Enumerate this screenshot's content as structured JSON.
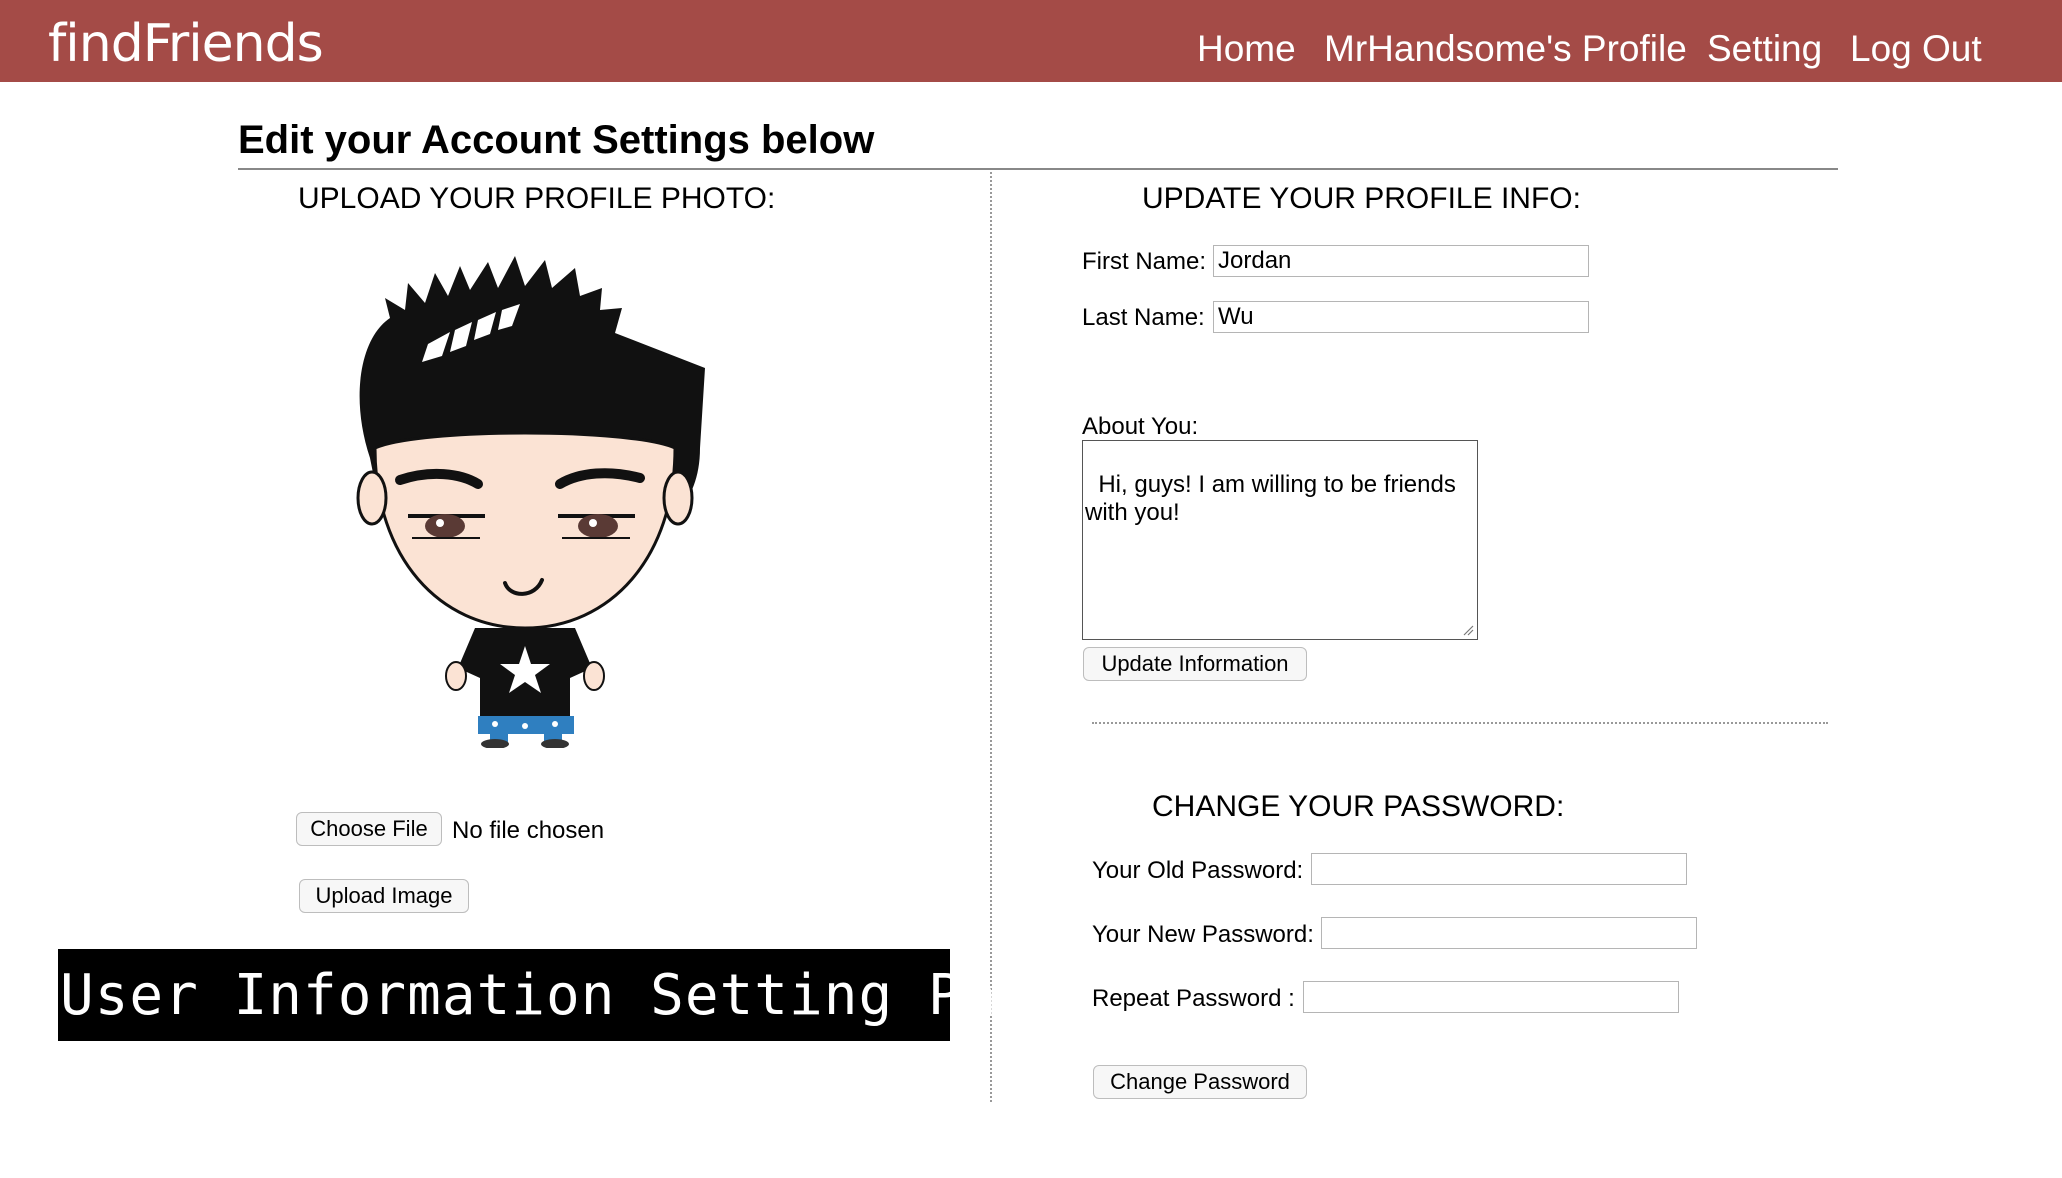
{
  "nav": {
    "brand": "findFriends",
    "links": [
      "Home",
      "MrHandsome's Profile",
      "Setting",
      "Log Out"
    ]
  },
  "page": {
    "heading": "Edit your Account Settings below"
  },
  "photo": {
    "title": "UPLOAD YOUR PROFILE PHOTO:",
    "choose_file_label": "Choose File",
    "file_status": "No file chosen",
    "upload_button": "Upload Image"
  },
  "profile": {
    "title": "UPDATE YOUR PROFILE INFO:",
    "first_name_label": "First Name:",
    "first_name_value": "Jordan",
    "last_name_label": "Last Name:",
    "last_name_value": "Wu",
    "about_label": "About You:",
    "about_value": "Hi, guys! I am willing to be friends\nwith you!",
    "update_button": "Update Information"
  },
  "password": {
    "title": "CHANGE YOUR PASSWORD:",
    "old_label": "Your Old Password:",
    "new_label": "Your New Password:",
    "repeat_label": "Repeat Password :",
    "change_button": "Change Password"
  },
  "banner": {
    "text": "User Information Setting Page"
  },
  "colors": {
    "navbar": "#a44b47"
  }
}
